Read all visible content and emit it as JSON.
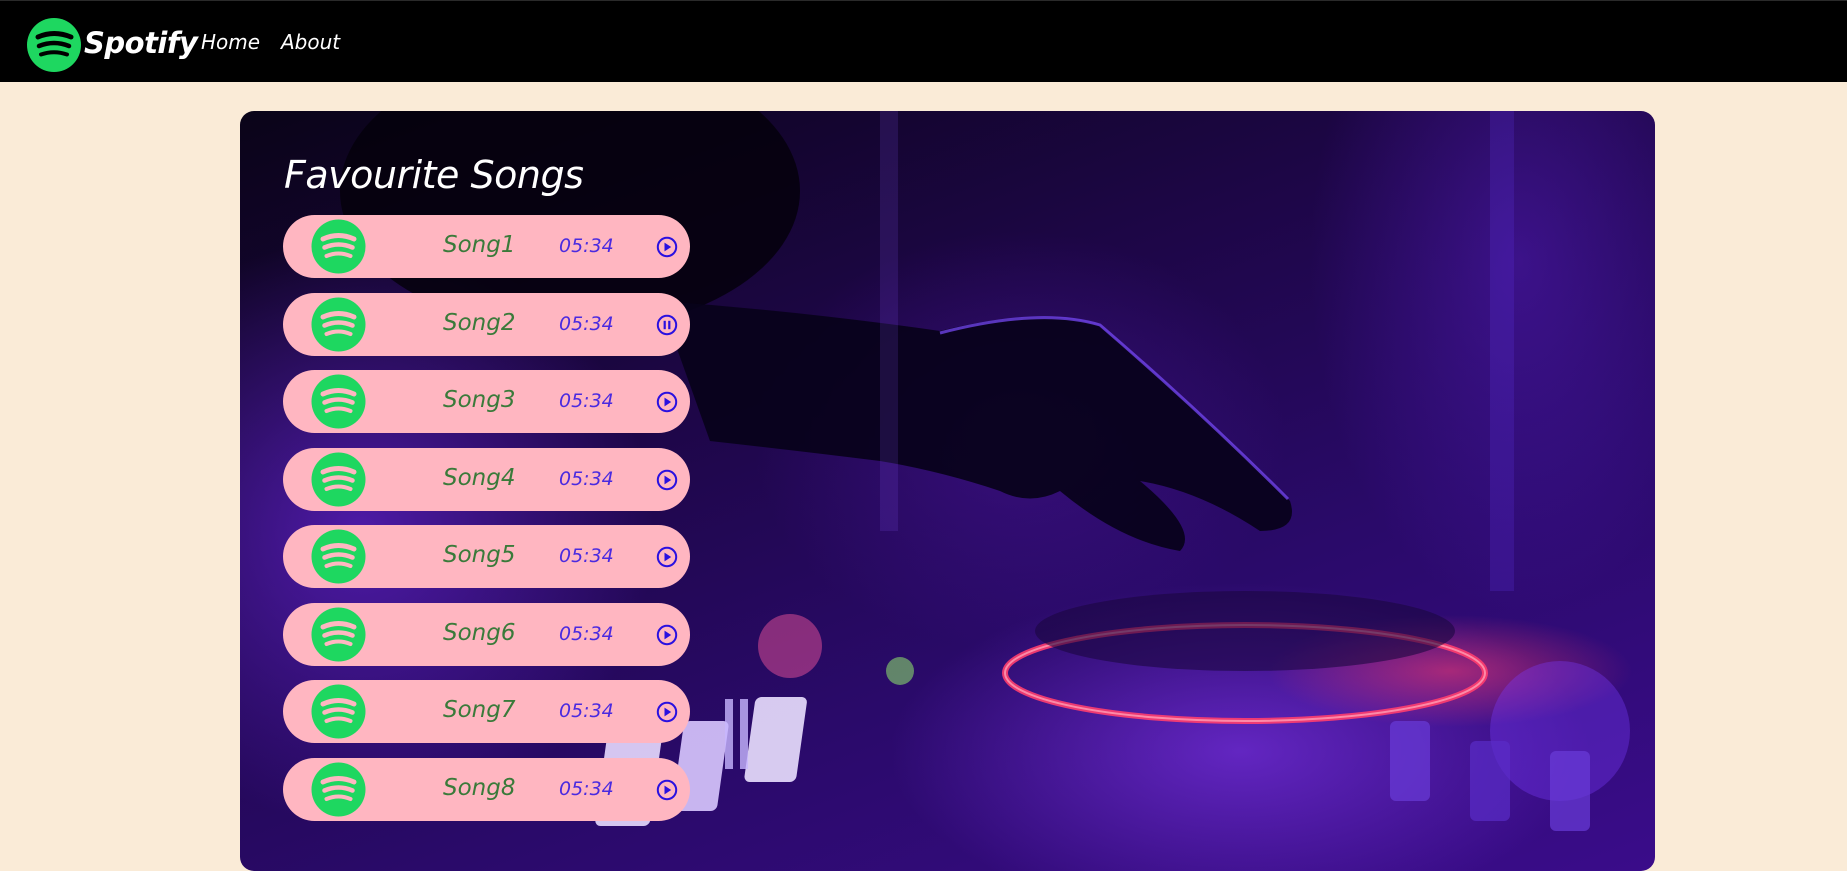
{
  "nav": {
    "brand": "Spotify",
    "links": [
      "Home",
      "About"
    ]
  },
  "main": {
    "title": "Favourite Songs",
    "songs": [
      {
        "name": "Song1",
        "duration": "05:34",
        "control": "play-circle-icon"
      },
      {
        "name": "Song2",
        "duration": "05:34",
        "control": "pause-circle-icon"
      },
      {
        "name": "Song3",
        "duration": "05:34",
        "control": "play-circle-icon"
      },
      {
        "name": "Song4",
        "duration": "05:34",
        "control": "play-circle-icon"
      },
      {
        "name": "Song5",
        "duration": "05:34",
        "control": "play-circle-icon"
      },
      {
        "name": "Song6",
        "duration": "05:34",
        "control": "play-circle-icon"
      },
      {
        "name": "Song7",
        "duration": "05:34",
        "control": "play-circle-icon"
      },
      {
        "name": "Song8",
        "duration": "05:34",
        "control": "play-circle-icon"
      }
    ]
  },
  "colors": {
    "page_bg": "#faebd7",
    "navbar_bg": "#000000",
    "song_item_bg": "#ffb6c1",
    "spotify_green": "#1ed760",
    "song_name": "#3a7a3a",
    "duration": "#4a2ae0",
    "control": "#2a10e0"
  }
}
